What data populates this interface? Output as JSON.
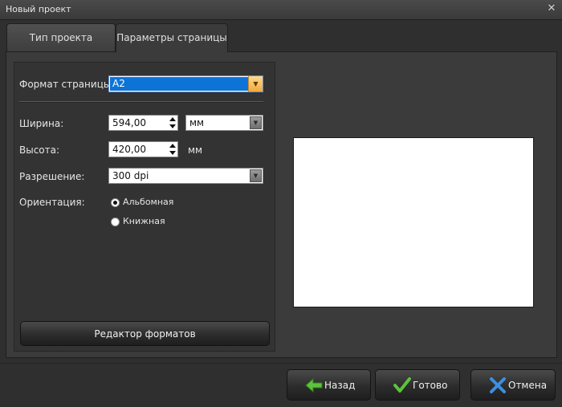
{
  "window": {
    "title": "Новый проект"
  },
  "tabs": [
    {
      "label": "Тип проекта"
    },
    {
      "label": "Параметры страницы"
    }
  ],
  "form": {
    "page_format": {
      "label": "Формат страницы:",
      "value": "A2"
    },
    "width": {
      "label": "Ширина:",
      "value": "594,00",
      "unit": "мм"
    },
    "height": {
      "label": "Высота:",
      "value": "420,00",
      "unit": "мм"
    },
    "resolution": {
      "label": "Разрешение:",
      "value": "300 dpi"
    },
    "orientation": {
      "label": "Ориентация:",
      "options": [
        "Альбомная",
        "Книжная"
      ],
      "selected": "Альбомная"
    },
    "formats_editor_label": "Редактор форматов"
  },
  "footer": {
    "back_label": "Назад",
    "done_label": "Готово",
    "cancel_label": "Отмена"
  },
  "icons": {
    "back": "arrow-left-icon",
    "done": "checkmark-icon",
    "cancel": "cross-icon",
    "close": "close-icon"
  },
  "colors": {
    "selection": "#0d74d7",
    "back_arrow": "#5cc33a",
    "done_check": "#5cc33a",
    "cancel_cross": "#3d8fe0"
  }
}
